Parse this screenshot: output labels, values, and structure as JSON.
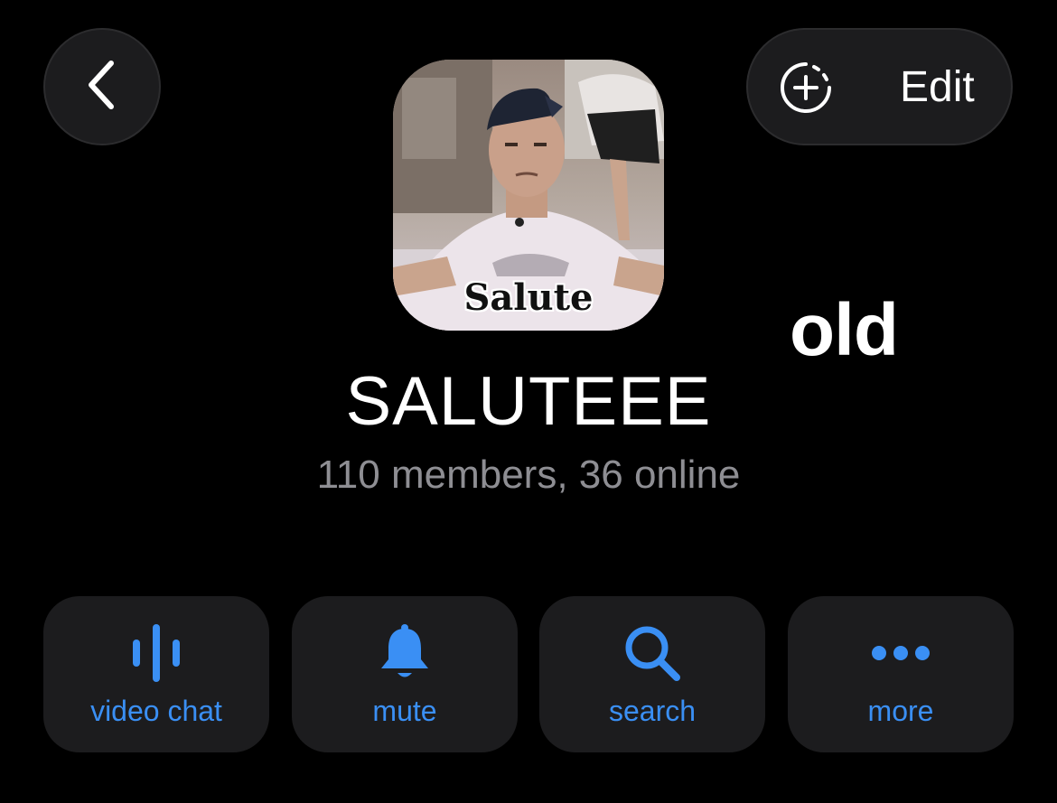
{
  "header": {
    "back_icon": "chevron-left-icon",
    "edit_icon": "add-circle-dashed-icon",
    "edit_label": "Edit"
  },
  "avatar": {
    "caption": "Salute"
  },
  "overlay": {
    "text": "old"
  },
  "group": {
    "title": "SALUTEEE",
    "subtitle": "110 members, 36 online"
  },
  "actions": [
    {
      "label": "video chat",
      "icon": "voice-waveform-icon"
    },
    {
      "label": "mute",
      "icon": "bell-icon"
    },
    {
      "label": "search",
      "icon": "search-icon"
    },
    {
      "label": "more",
      "icon": "more-dots-icon"
    }
  ],
  "colors": {
    "background": "#000000",
    "button_bg": "#1c1c1e",
    "accent": "#3a8ff4",
    "subtitle": "#8e8e93",
    "text": "#ffffff"
  }
}
